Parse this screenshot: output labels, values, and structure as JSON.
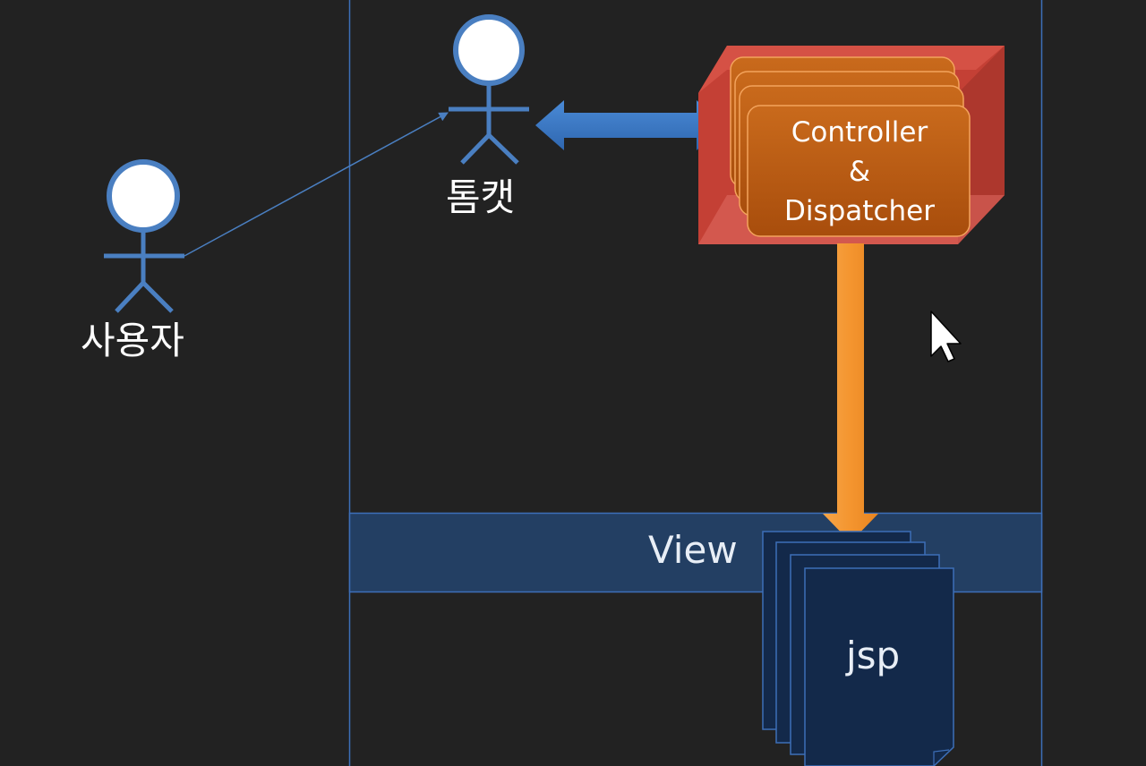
{
  "actors": {
    "user": {
      "label": "사용자"
    },
    "tomcat": {
      "label": "톰캣"
    }
  },
  "controller": {
    "line1": "Controller",
    "line2": "&",
    "line3": "Dispatcher"
  },
  "view": {
    "label": "View"
  },
  "jsp": {
    "label": "jsp"
  },
  "colors": {
    "background": "#222222",
    "actor_stroke": "#4a7fc1",
    "actor_head_fill": "#ffffff",
    "double_arrow": "#3a78c4",
    "container_red": "#c9453a",
    "card_orange": "#b5540f",
    "down_arrow": "#f4952f",
    "view_band": "#233f63",
    "jsp_page": "#13294a",
    "border_blue": "#3d6fb8"
  }
}
